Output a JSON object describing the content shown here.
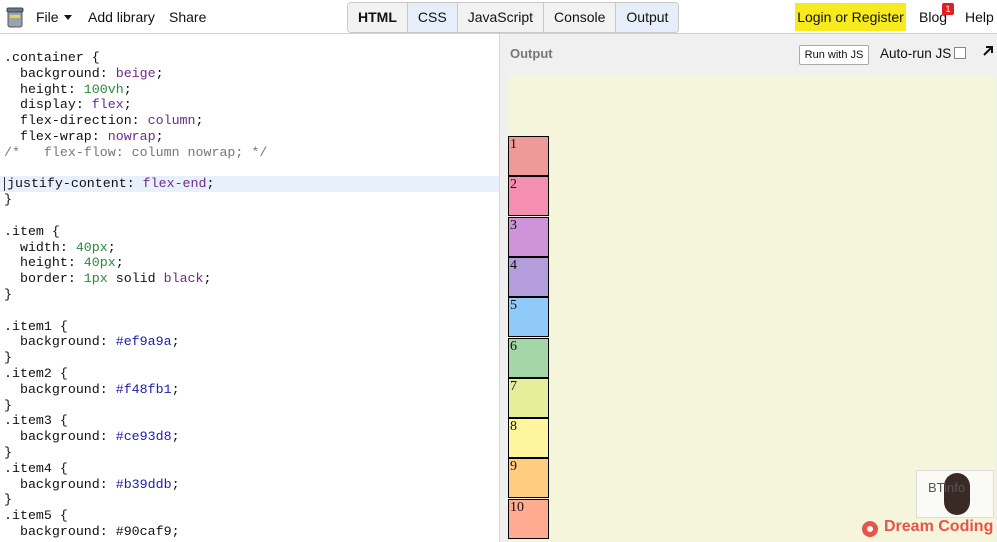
{
  "topbar": {
    "file_label": "File",
    "add_library_label": "Add library",
    "share_label": "Share",
    "tabs": [
      "HTML",
      "CSS",
      "JavaScript",
      "Console",
      "Output"
    ],
    "login_label": "Login or Register",
    "blog_label": "Blog",
    "blog_badge": "1",
    "help_label": "Help"
  },
  "output": {
    "title": "Output",
    "run_button": "Run with JS",
    "autorun_label": "Auto-run JS",
    "items": [
      "1",
      "2",
      "3",
      "4",
      "5",
      "6",
      "7",
      "8",
      "9",
      "10"
    ],
    "item_colors": [
      "#ef9a9a",
      "#f48fb1",
      "#ce93d8",
      "#b39ddb",
      "#90caf9",
      "#a5d6a7",
      "#e6ee9c",
      "#fff59d",
      "#ffcc80",
      "#ffab91"
    ]
  },
  "watermark": {
    "text": "BTinfo",
    "brand": "Dream Coding"
  },
  "code": {
    "l1": ".container {",
    "l2a": "  background: ",
    "l2b": "beige",
    "l2c": ";",
    "l3a": "  height: ",
    "l3b": "100vh",
    "l3c": ";",
    "l4a": "  display: ",
    "l4b": "flex",
    "l4c": ";",
    "l5a": "  flex-direction: ",
    "l5b": "column",
    "l5c": ";",
    "l6a": "  flex-wrap: ",
    "l6b": "nowrap",
    "l6c": ";",
    "l7": "/*   flex-flow: column nowrap; */",
    "l9a": "justify-content: ",
    "l9b": "flex-end",
    "l9c": ";",
    "l10": "}",
    "l12": ".item {",
    "l13a": "  width: ",
    "l13b": "40px",
    "l13c": ";",
    "l14a": "  height: ",
    "l14b": "40px",
    "l14c": ";",
    "l15a": "  border: ",
    "l15b": "1px",
    "l15c": " solid ",
    "l15d": "black",
    "l15e": ";",
    "l16": "}",
    "l18": ".item1 {",
    "l19a": "  background: ",
    "l19b": "#ef9a9a",
    "l19c": ";",
    "l20": "}",
    "l21": ".item2 {",
    "l22a": "  background: ",
    "l22b": "#f48fb1",
    "l22c": ";",
    "l23": "}",
    "l24": ".item3 {",
    "l25a": "  background: ",
    "l25b": "#ce93d8",
    "l25c": ";",
    "l26": "}",
    "l27": ".item4 {",
    "l28a": "  background: ",
    "l28b": "#b39ddb",
    "l28c": ";",
    "l29": "}",
    "l30": ".item5 {",
    "l31": "  background: #90caf9;"
  }
}
